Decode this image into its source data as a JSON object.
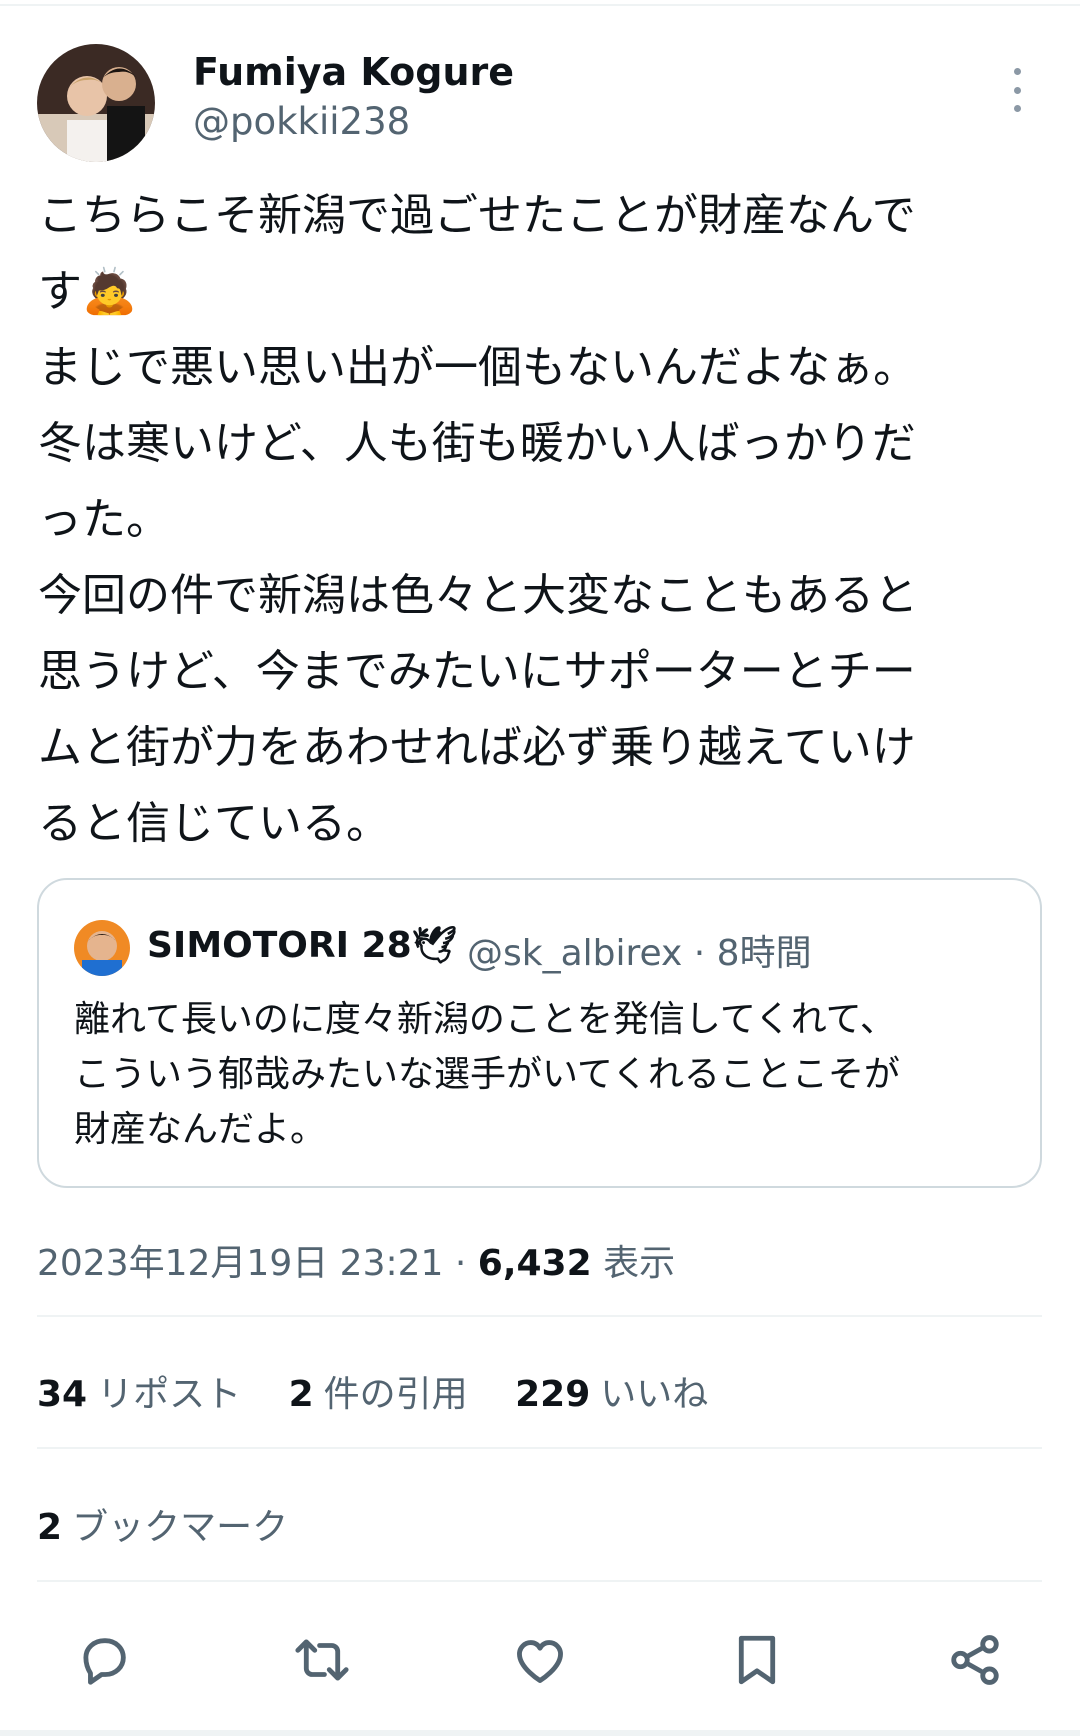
{
  "author": {
    "name": "Fumiya Kogure",
    "handle": "@pokkii238",
    "avatar_icon": "profile-photo"
  },
  "tweet": {
    "lines": [
      "こちらこそ新潟で過ごせたことが財産なんで",
      "す🙇",
      "まじで悪い思い出が一個もないんだよなぁ。",
      "冬は寒いけど、人も街も暖かい人ばっかりだ",
      "った。",
      "今回の件で新潟は色々と大変なこともあると",
      "思うけど、今までみたいにサポーターとチー",
      "ムと街が力をあわせれば必ず乗り越えていけ",
      "ると信じている。"
    ]
  },
  "quote": {
    "name": "SIMOTORI 28🕊",
    "meta": "@sk_albirex · 8時間",
    "lines": [
      "離れて長いのに度々新潟のことを発信してくれて、",
      "こういう郁哉みたいな選手がいてくれることこそが",
      "財産なんだよ。"
    ]
  },
  "timestamp": {
    "datetime": "2023年12月19日 23:21 · ",
    "views_count": "6,432",
    "views_label": " 表示"
  },
  "stats": {
    "reposts_count": "34",
    "reposts_label": "リポスト",
    "quotes_count": "2",
    "quotes_label": "件の引用",
    "likes_count": "229",
    "likes_label": "いいね"
  },
  "bookmarks": {
    "count": "2",
    "label": "ブックマーク"
  },
  "actions": [
    "reply-icon",
    "repost-icon",
    "like-icon",
    "bookmark-icon",
    "share-icon"
  ],
  "colors": {
    "text": "#0f1419",
    "secondary": "#536471",
    "border": "#cfd9de",
    "divider": "#eff3f4"
  }
}
